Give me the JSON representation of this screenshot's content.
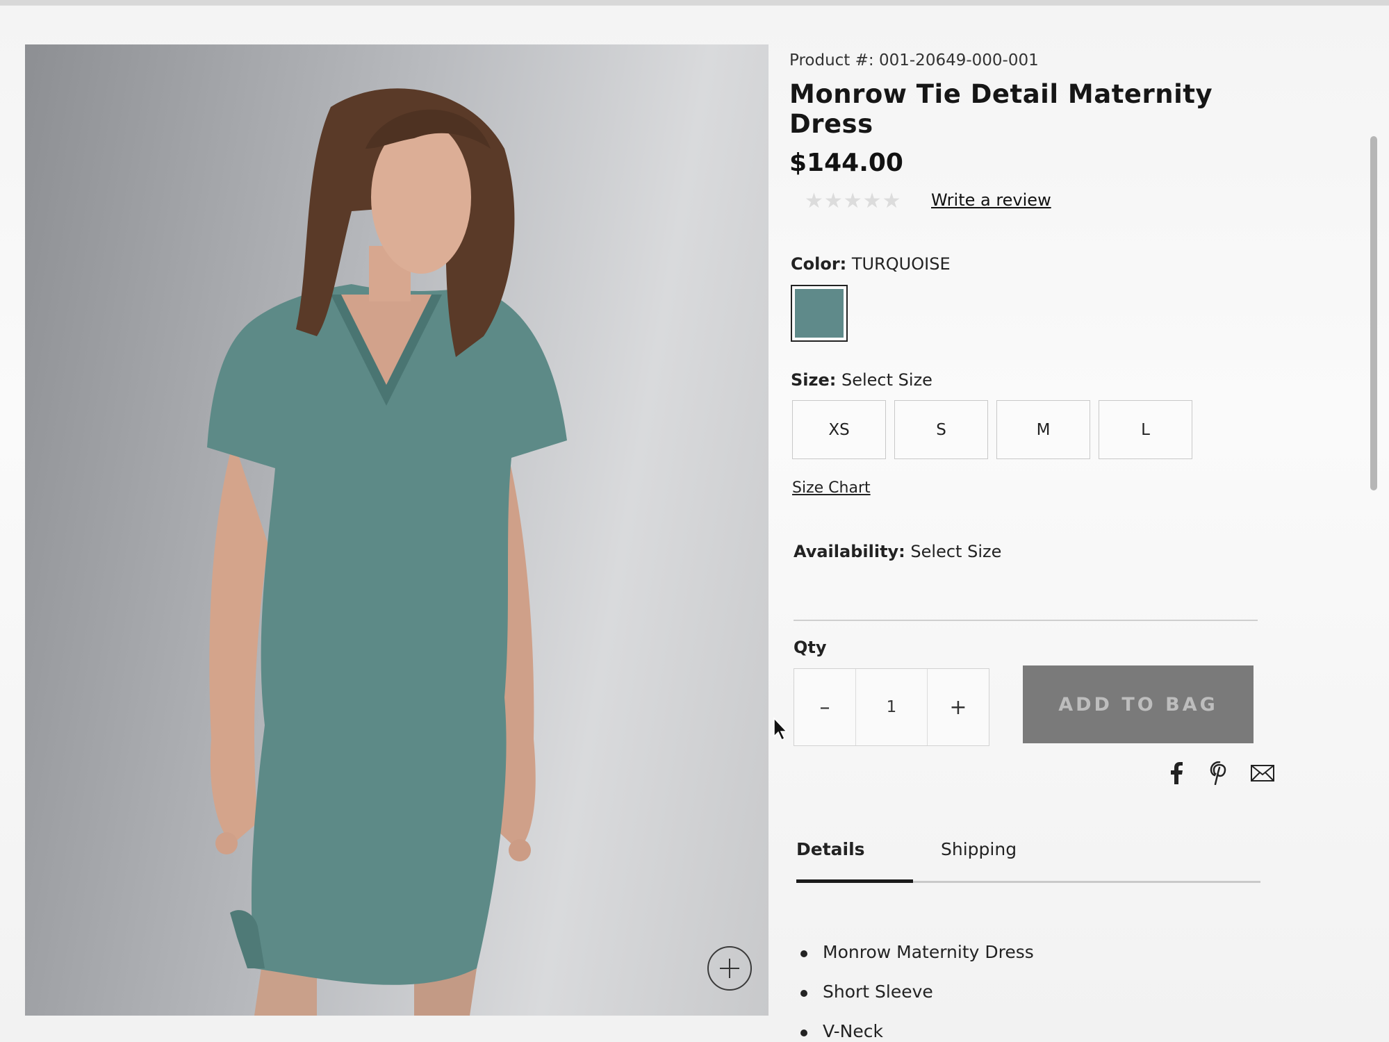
{
  "product": {
    "number_label": "Product #:",
    "number": "001-20649-000-001",
    "title": "Monrow Tie Detail Maternity Dress",
    "price": "$144.00",
    "rating_stars": "★★★★★",
    "write_review": "Write a review"
  },
  "color": {
    "label": "Color:",
    "value": "TURQUOISE",
    "swatch_color": "#5f8a8a"
  },
  "size": {
    "label": "Size:",
    "value": "Select Size",
    "options": [
      "XS",
      "S",
      "M",
      "L"
    ],
    "chart_link": "Size Chart"
  },
  "availability": {
    "label": "Availability:",
    "value": "Select Size"
  },
  "quantity": {
    "label": "Qty",
    "minus": "–",
    "value": "1",
    "plus": "+"
  },
  "cart": {
    "add_label": "ADD TO BAG",
    "button_color": "#7a7a7a"
  },
  "share": {
    "icons": [
      "facebook-icon",
      "pinterest-icon",
      "email-icon"
    ]
  },
  "tabs": {
    "details": "Details",
    "shipping": "Shipping",
    "active": "Details"
  },
  "details_list": [
    "Monrow Maternity Dress",
    "Short Sleeve",
    "V-Neck"
  ]
}
